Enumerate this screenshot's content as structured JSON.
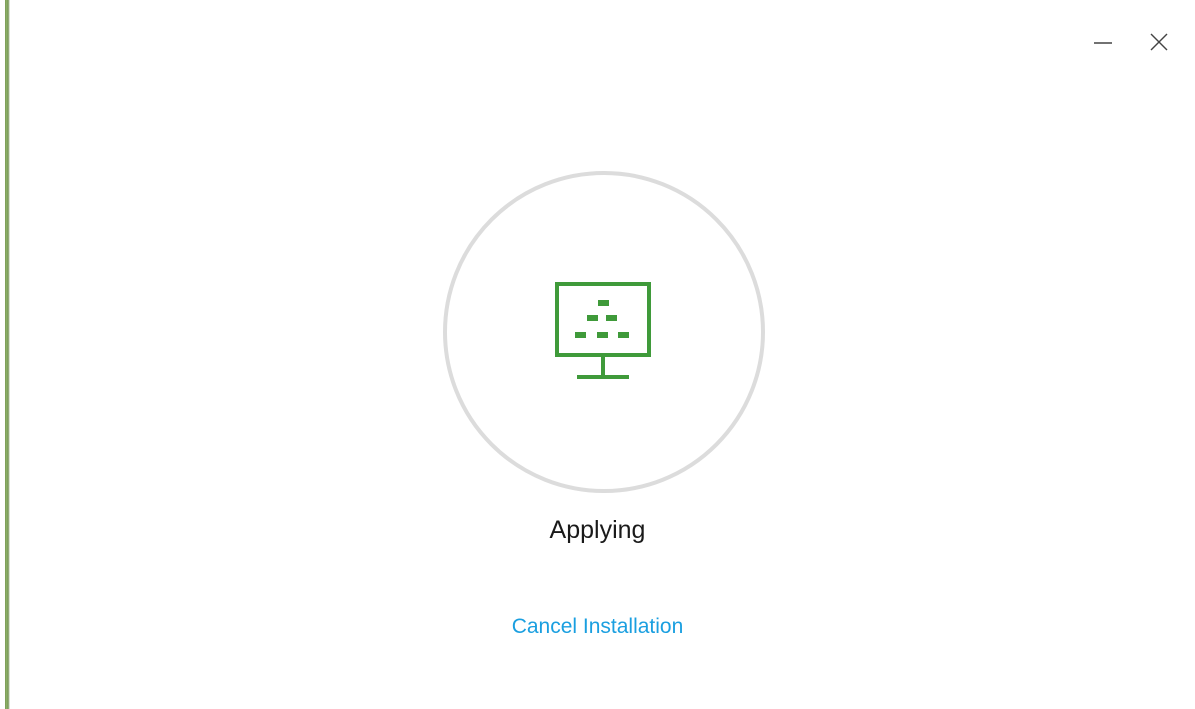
{
  "window": {
    "minimize_icon": "minimize-icon",
    "close_icon": "close-icon"
  },
  "main": {
    "icon": "monitor-network-icon",
    "status": "Applying",
    "cancel_label": "Cancel Installation"
  },
  "colors": {
    "accent_green": "#3f9a3a",
    "link_blue": "#1a9fe0",
    "ring_gray": "#dcdcdc"
  }
}
